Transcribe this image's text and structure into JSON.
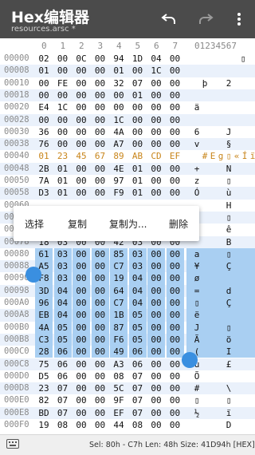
{
  "appbar": {
    "title": "Hex编辑器",
    "subtitle": "resources.arsc *",
    "undo_icon": "undo-icon",
    "redo_icon": "redo-icon",
    "more_icon": "more-vert-icon"
  },
  "header": {
    "hex_cols": [
      "0",
      "1",
      "2",
      "3",
      "4",
      "5",
      "6",
      "7"
    ],
    "text_cols": "01234567"
  },
  "rows": [
    {
      "off": "00000",
      "hex": [
        "02",
        "00",
        "0C",
        "00",
        "94",
        "1D",
        "04",
        "00"
      ],
      "txt": [
        "",
        "",
        "",
        "",
        "",
        "",
        "",
        ""
      ],
      "extra": "▯"
    },
    {
      "off": "00008",
      "hex": [
        "01",
        "00",
        "00",
        "00",
        "01",
        "00",
        "1C",
        "00"
      ],
      "txt": [
        "",
        "",
        "",
        "",
        "",
        "",
        "",
        ""
      ]
    },
    {
      "off": "00010",
      "hex": [
        "00",
        "FE",
        "00",
        "00",
        "32",
        "07",
        "00",
        "00"
      ],
      "txt": [
        "",
        "þ",
        "",
        "",
        "2",
        "",
        "",
        ""
      ]
    },
    {
      "off": "00018",
      "hex": [
        "00",
        "00",
        "00",
        "00",
        "00",
        "01",
        "00",
        "00"
      ],
      "txt": [
        "",
        "",
        "",
        "",
        "",
        "",
        "",
        ""
      ]
    },
    {
      "off": "00020",
      "hex": [
        "E4",
        "1C",
        "00",
        "00",
        "00",
        "00",
        "00",
        "00"
      ],
      "txt": [
        "ä",
        "",
        "",
        "",
        "",
        "",
        "",
        ""
      ]
    },
    {
      "off": "00028",
      "hex": [
        "00",
        "00",
        "00",
        "00",
        "1C",
        "00",
        "00",
        "00"
      ],
      "txt": [
        "",
        "",
        "",
        "",
        "",
        "",
        "",
        ""
      ]
    },
    {
      "off": "00030",
      "hex": [
        "36",
        "00",
        "00",
        "00",
        "4A",
        "00",
        "00",
        "00"
      ],
      "txt": [
        "6",
        "",
        "",
        "",
        "J",
        "",
        "",
        ""
      ]
    },
    {
      "off": "00038",
      "hex": [
        "76",
        "00",
        "00",
        "00",
        "A7",
        "00",
        "00",
        "00"
      ],
      "txt": [
        "v",
        "",
        "",
        "",
        "§",
        "",
        "",
        ""
      ]
    },
    {
      "off": "00040",
      "hex": [
        "01",
        "23",
        "45",
        "67",
        "89",
        "AB",
        "CD",
        "EF"
      ],
      "txt": [
        "",
        "#",
        "E",
        "g",
        "▯",
        "«",
        "Í",
        "ï"
      ],
      "highlight": true
    },
    {
      "off": "00048",
      "hex": [
        "2B",
        "01",
        "00",
        "00",
        "4E",
        "01",
        "00",
        "00"
      ],
      "txt": [
        "+",
        "",
        "",
        "",
        "N",
        "",
        "",
        ""
      ]
    },
    {
      "off": "00050",
      "hex": [
        "7A",
        "01",
        "00",
        "00",
        "97",
        "01",
        "00",
        "00"
      ],
      "txt": [
        "z",
        "",
        "",
        "",
        "▯",
        "",
        "",
        ""
      ]
    },
    {
      "off": "00058",
      "hex": [
        "D3",
        "01",
        "00",
        "00",
        "F9",
        "01",
        "00",
        "00"
      ],
      "txt": [
        "Ó",
        "",
        "",
        "",
        "ù",
        "",
        "",
        ""
      ]
    },
    {
      "off": "00060",
      "hex": [
        "",
        "",
        "",
        "",
        "",
        "",
        "",
        ""
      ],
      "txt": [
        "",
        "",
        "",
        "",
        "H",
        "",
        "",
        ""
      ]
    },
    {
      "off": "00068",
      "hex": [
        "",
        "",
        "",
        "",
        "",
        "",
        "",
        ""
      ],
      "txt": [
        "",
        "",
        "",
        "",
        "▯",
        "",
        "",
        ""
      ]
    },
    {
      "off": "00070",
      "hex": [
        "",
        "",
        "",
        "",
        "",
        "",
        "",
        ""
      ],
      "txt": [
        "",
        "",
        "",
        "",
        "ê",
        "",
        "",
        ""
      ]
    },
    {
      "off": "00078",
      "hex": [
        "18",
        "03",
        "00",
        "00",
        "42",
        "03",
        "00",
        "00"
      ],
      "txt": [
        "",
        "",
        "",
        "",
        "B",
        "",
        "",
        ""
      ]
    },
    {
      "off": "00080",
      "hex": [
        "61",
        "03",
        "00",
        "00",
        "85",
        "03",
        "00",
        "00"
      ],
      "txt": [
        "a",
        "",
        "",
        "",
        "▯",
        "",
        "",
        ""
      ],
      "sel": "partial-right"
    },
    {
      "off": "00088",
      "hex": [
        "A5",
        "03",
        "00",
        "00",
        "C7",
        "03",
        "00",
        "00"
      ],
      "txt": [
        "¥",
        "",
        "",
        "",
        "Ç",
        "",
        "",
        ""
      ],
      "sel": "all"
    },
    {
      "off": "00090",
      "hex": [
        "F8",
        "03",
        "00",
        "00",
        "19",
        "04",
        "00",
        "00"
      ],
      "txt": [
        "ø",
        "",
        "",
        "",
        "",
        "",
        "",
        ""
      ],
      "sel": "all"
    },
    {
      "off": "00098",
      "hex": [
        "3D",
        "04",
        "00",
        "00",
        "64",
        "04",
        "00",
        "00"
      ],
      "txt": [
        "=",
        "",
        "",
        "",
        "d",
        "",
        "",
        ""
      ],
      "sel": "all"
    },
    {
      "off": "000A0",
      "hex": [
        "96",
        "04",
        "00",
        "00",
        "C7",
        "04",
        "00",
        "00"
      ],
      "txt": [
        "▯",
        "",
        "",
        "",
        "Ç",
        "",
        "",
        ""
      ],
      "sel": "all"
    },
    {
      "off": "000A8",
      "hex": [
        "EB",
        "04",
        "00",
        "00",
        "1B",
        "05",
        "00",
        "00"
      ],
      "txt": [
        "ë",
        "",
        "",
        "",
        "",
        "",
        "",
        ""
      ],
      "sel": "all"
    },
    {
      "off": "000B0",
      "hex": [
        "4A",
        "05",
        "00",
        "00",
        "87",
        "05",
        "00",
        "00"
      ],
      "txt": [
        "J",
        "",
        "",
        "",
        "▯",
        "",
        "",
        ""
      ],
      "sel": "all"
    },
    {
      "off": "000B8",
      "hex": [
        "C3",
        "05",
        "00",
        "00",
        "F6",
        "05",
        "00",
        "00"
      ],
      "txt": [
        "Ã",
        "",
        "",
        "",
        "ö",
        "",
        "",
        ""
      ],
      "sel": "all"
    },
    {
      "off": "000C0",
      "hex": [
        "28",
        "06",
        "00",
        "00",
        "49",
        "06",
        "00",
        "00"
      ],
      "txt": [
        "(",
        "",
        "",
        "",
        "I",
        "",
        "",
        ""
      ],
      "sel": "all"
    },
    {
      "off": "000C8",
      "hex": [
        "75",
        "06",
        "00",
        "00",
        "A3",
        "06",
        "00",
        "00"
      ],
      "txt": [
        "u",
        "",
        "",
        "",
        "£",
        "",
        "",
        ""
      ]
    },
    {
      "off": "000D0",
      "hex": [
        "D5",
        "06",
        "00",
        "00",
        "08",
        "07",
        "00",
        "00"
      ],
      "txt": [
        "Õ",
        "",
        "",
        "",
        "",
        "",
        "",
        ""
      ]
    },
    {
      "off": "000D8",
      "hex": [
        "23",
        "07",
        "00",
        "00",
        "5C",
        "07",
        "00",
        "00"
      ],
      "txt": [
        "#",
        "",
        "",
        "",
        "\\",
        "",
        "",
        ""
      ]
    },
    {
      "off": "000E0",
      "hex": [
        "82",
        "07",
        "00",
        "00",
        "9F",
        "07",
        "00",
        "00"
      ],
      "txt": [
        "▯",
        "",
        "",
        "",
        "▯",
        "",
        "",
        ""
      ]
    },
    {
      "off": "000E8",
      "hex": [
        "BD",
        "07",
        "00",
        "00",
        "EF",
        "07",
        "00",
        "00"
      ],
      "txt": [
        "½",
        "",
        "",
        "",
        "ï",
        "",
        "",
        ""
      ]
    },
    {
      "off": "000F0",
      "hex": [
        "19",
        "08",
        "00",
        "00",
        "44",
        "08",
        "00",
        "00"
      ],
      "txt": [
        "",
        "",
        "",
        "",
        "D",
        "",
        "",
        ""
      ]
    }
  ],
  "popup": {
    "items": [
      "选择",
      "复制",
      "复制为...",
      "删除"
    ]
  },
  "status": {
    "text": "Sel: 80h - C7h  Len: 48h  Size: 41D94h [HEX]",
    "keyboard_icon": "keyboard-icon"
  },
  "colors": {
    "appbar": "#4b4b4b",
    "selection": "#a9cff2",
    "highlight": "#c8851a",
    "handle": "#3a8fe0"
  }
}
